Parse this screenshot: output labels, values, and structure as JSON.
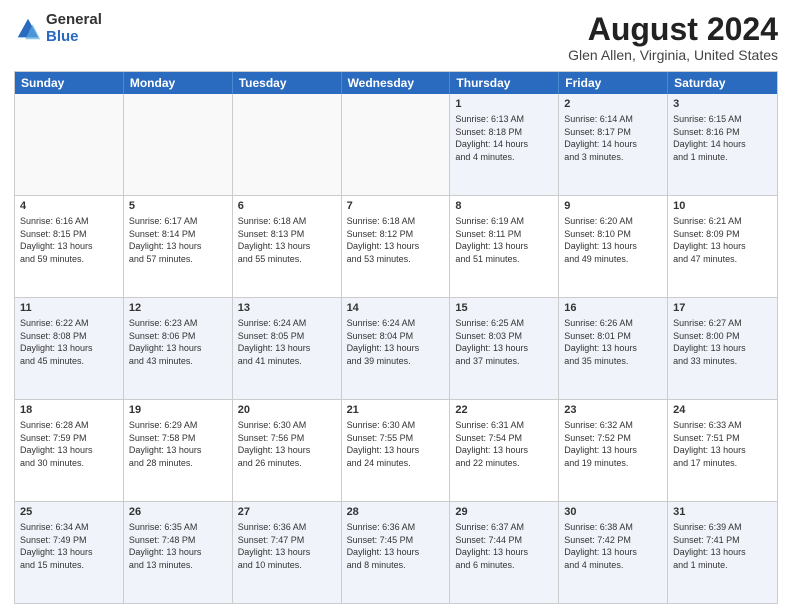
{
  "header": {
    "logo": {
      "general": "General",
      "blue": "Blue"
    },
    "title": "August 2024",
    "subtitle": "Glen Allen, Virginia, United States"
  },
  "calendar": {
    "days": [
      "Sunday",
      "Monday",
      "Tuesday",
      "Wednesday",
      "Thursday",
      "Friday",
      "Saturday"
    ],
    "rows": [
      [
        {
          "day": "",
          "info": ""
        },
        {
          "day": "",
          "info": ""
        },
        {
          "day": "",
          "info": ""
        },
        {
          "day": "",
          "info": ""
        },
        {
          "day": "1",
          "info": "Sunrise: 6:13 AM\nSunset: 8:18 PM\nDaylight: 14 hours\nand 4 minutes."
        },
        {
          "day": "2",
          "info": "Sunrise: 6:14 AM\nSunset: 8:17 PM\nDaylight: 14 hours\nand 3 minutes."
        },
        {
          "day": "3",
          "info": "Sunrise: 6:15 AM\nSunset: 8:16 PM\nDaylight: 14 hours\nand 1 minute."
        }
      ],
      [
        {
          "day": "4",
          "info": "Sunrise: 6:16 AM\nSunset: 8:15 PM\nDaylight: 13 hours\nand 59 minutes."
        },
        {
          "day": "5",
          "info": "Sunrise: 6:17 AM\nSunset: 8:14 PM\nDaylight: 13 hours\nand 57 minutes."
        },
        {
          "day": "6",
          "info": "Sunrise: 6:18 AM\nSunset: 8:13 PM\nDaylight: 13 hours\nand 55 minutes."
        },
        {
          "day": "7",
          "info": "Sunrise: 6:18 AM\nSunset: 8:12 PM\nDaylight: 13 hours\nand 53 minutes."
        },
        {
          "day": "8",
          "info": "Sunrise: 6:19 AM\nSunset: 8:11 PM\nDaylight: 13 hours\nand 51 minutes."
        },
        {
          "day": "9",
          "info": "Sunrise: 6:20 AM\nSunset: 8:10 PM\nDaylight: 13 hours\nand 49 minutes."
        },
        {
          "day": "10",
          "info": "Sunrise: 6:21 AM\nSunset: 8:09 PM\nDaylight: 13 hours\nand 47 minutes."
        }
      ],
      [
        {
          "day": "11",
          "info": "Sunrise: 6:22 AM\nSunset: 8:08 PM\nDaylight: 13 hours\nand 45 minutes."
        },
        {
          "day": "12",
          "info": "Sunrise: 6:23 AM\nSunset: 8:06 PM\nDaylight: 13 hours\nand 43 minutes."
        },
        {
          "day": "13",
          "info": "Sunrise: 6:24 AM\nSunset: 8:05 PM\nDaylight: 13 hours\nand 41 minutes."
        },
        {
          "day": "14",
          "info": "Sunrise: 6:24 AM\nSunset: 8:04 PM\nDaylight: 13 hours\nand 39 minutes."
        },
        {
          "day": "15",
          "info": "Sunrise: 6:25 AM\nSunset: 8:03 PM\nDaylight: 13 hours\nand 37 minutes."
        },
        {
          "day": "16",
          "info": "Sunrise: 6:26 AM\nSunset: 8:01 PM\nDaylight: 13 hours\nand 35 minutes."
        },
        {
          "day": "17",
          "info": "Sunrise: 6:27 AM\nSunset: 8:00 PM\nDaylight: 13 hours\nand 33 minutes."
        }
      ],
      [
        {
          "day": "18",
          "info": "Sunrise: 6:28 AM\nSunset: 7:59 PM\nDaylight: 13 hours\nand 30 minutes."
        },
        {
          "day": "19",
          "info": "Sunrise: 6:29 AM\nSunset: 7:58 PM\nDaylight: 13 hours\nand 28 minutes."
        },
        {
          "day": "20",
          "info": "Sunrise: 6:30 AM\nSunset: 7:56 PM\nDaylight: 13 hours\nand 26 minutes."
        },
        {
          "day": "21",
          "info": "Sunrise: 6:30 AM\nSunset: 7:55 PM\nDaylight: 13 hours\nand 24 minutes."
        },
        {
          "day": "22",
          "info": "Sunrise: 6:31 AM\nSunset: 7:54 PM\nDaylight: 13 hours\nand 22 minutes."
        },
        {
          "day": "23",
          "info": "Sunrise: 6:32 AM\nSunset: 7:52 PM\nDaylight: 13 hours\nand 19 minutes."
        },
        {
          "day": "24",
          "info": "Sunrise: 6:33 AM\nSunset: 7:51 PM\nDaylight: 13 hours\nand 17 minutes."
        }
      ],
      [
        {
          "day": "25",
          "info": "Sunrise: 6:34 AM\nSunset: 7:49 PM\nDaylight: 13 hours\nand 15 minutes."
        },
        {
          "day": "26",
          "info": "Sunrise: 6:35 AM\nSunset: 7:48 PM\nDaylight: 13 hours\nand 13 minutes."
        },
        {
          "day": "27",
          "info": "Sunrise: 6:36 AM\nSunset: 7:47 PM\nDaylight: 13 hours\nand 10 minutes."
        },
        {
          "day": "28",
          "info": "Sunrise: 6:36 AM\nSunset: 7:45 PM\nDaylight: 13 hours\nand 8 minutes."
        },
        {
          "day": "29",
          "info": "Sunrise: 6:37 AM\nSunset: 7:44 PM\nDaylight: 13 hours\nand 6 minutes."
        },
        {
          "day": "30",
          "info": "Sunrise: 6:38 AM\nSunset: 7:42 PM\nDaylight: 13 hours\nand 4 minutes."
        },
        {
          "day": "31",
          "info": "Sunrise: 6:39 AM\nSunset: 7:41 PM\nDaylight: 13 hours\nand 1 minute."
        }
      ]
    ]
  }
}
